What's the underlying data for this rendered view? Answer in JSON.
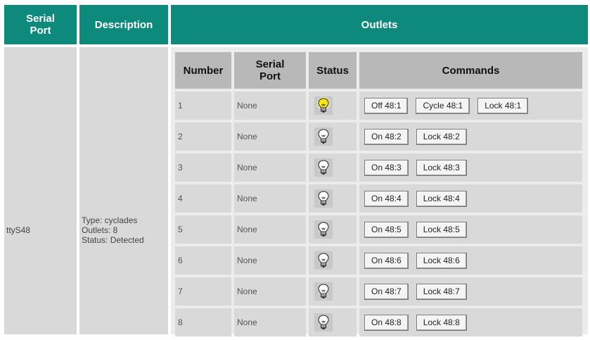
{
  "header": {
    "serial_port": "Serial Port",
    "description": "Description",
    "outlets": "Outlets"
  },
  "port": {
    "name": "ttyS48",
    "description_lines": [
      "Type: cyclades",
      "Outlets: 8",
      "Status: Detected"
    ]
  },
  "outlets_table": {
    "headers": {
      "number": "Number",
      "serial_port": "Serial Port",
      "status": "Status",
      "commands": "Commands"
    },
    "rows": [
      {
        "number": "1",
        "serial_port": "None",
        "status": "on",
        "commands": [
          "Off 48:1",
          "Cycle 48:1",
          "Lock 48:1"
        ]
      },
      {
        "number": "2",
        "serial_port": "None",
        "status": "off",
        "commands": [
          "On 48:2",
          "Lock 48:2"
        ]
      },
      {
        "number": "3",
        "serial_port": "None",
        "status": "off",
        "commands": [
          "On 48:3",
          "Lock 48:3"
        ]
      },
      {
        "number": "4",
        "serial_port": "None",
        "status": "off",
        "commands": [
          "On 48:4",
          "Lock 48:4"
        ]
      },
      {
        "number": "5",
        "serial_port": "None",
        "status": "off",
        "commands": [
          "On 48:5",
          "Lock 48:5"
        ]
      },
      {
        "number": "6",
        "serial_port": "None",
        "status": "off",
        "commands": [
          "On 48:6",
          "Lock 48:6"
        ]
      },
      {
        "number": "7",
        "serial_port": "None",
        "status": "off",
        "commands": [
          "On 48:7",
          "Lock 48:7"
        ]
      },
      {
        "number": "8",
        "serial_port": "None",
        "status": "off",
        "commands": [
          "On 48:8",
          "Lock 48:8"
        ]
      }
    ]
  },
  "colors": {
    "header_bg": "#0e8a7d",
    "cell_bg": "#d9d9d9",
    "inner_header_bg": "#b8b8b8",
    "bulb_on": "#f5e614"
  },
  "icons": {
    "status_on": "lightbulb-on-icon",
    "status_off": "lightbulb-off-icon"
  }
}
